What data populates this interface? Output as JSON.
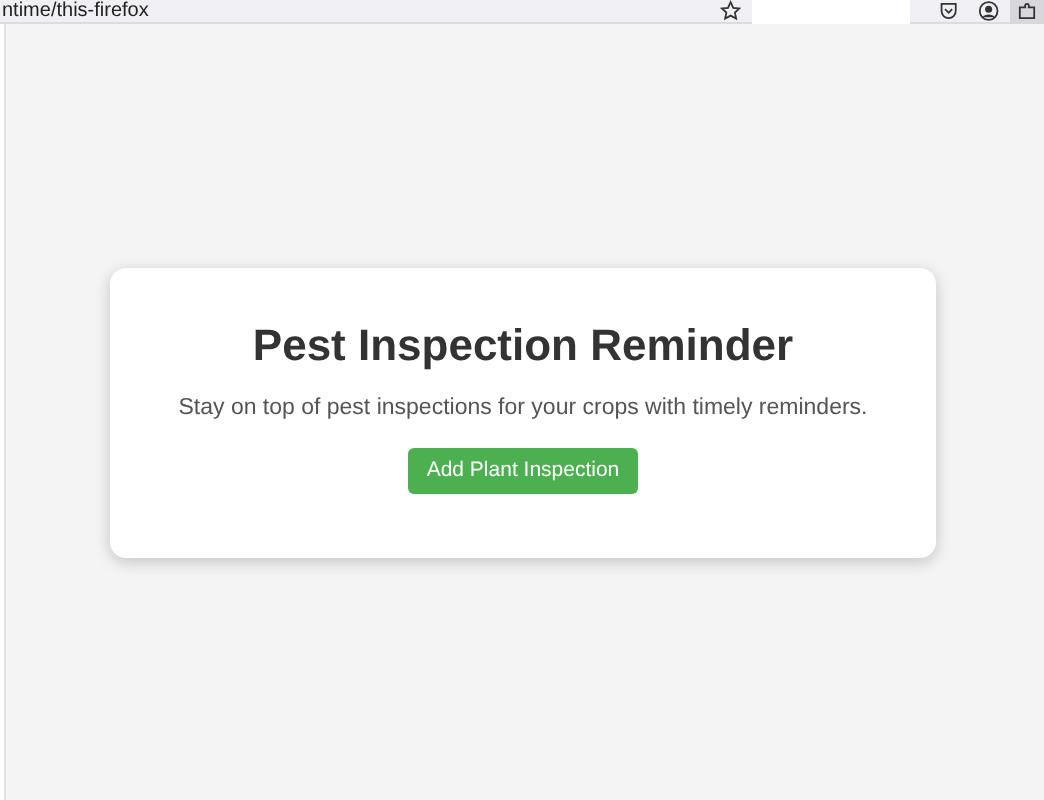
{
  "browser": {
    "url": "ntime/this-firefox"
  },
  "card": {
    "title": "Pest Inspection Reminder",
    "description": "Stay on top of pest inspections for your crops with timely reminders.",
    "button": "Add Plant Inspection"
  }
}
